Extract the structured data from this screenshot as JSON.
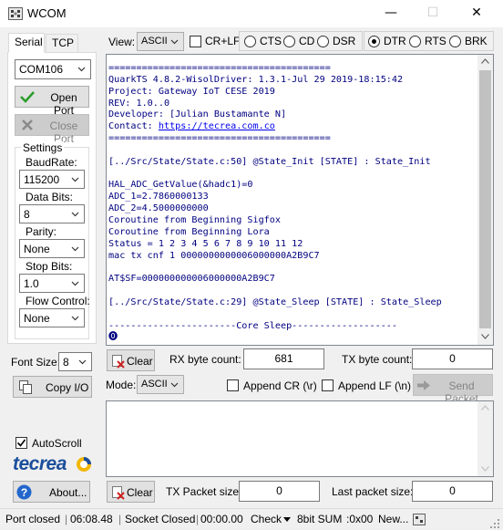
{
  "window": {
    "title": "WCOM",
    "icon": "serial-port-icon",
    "controls": [
      "minimize-icon",
      "maximize-icon",
      "close-icon"
    ]
  },
  "left_panel": {
    "tabs": [
      {
        "label": "Serial",
        "active": true
      },
      {
        "label": "TCP",
        "active": false
      }
    ],
    "port": "COM106",
    "open_port_label": "Open Port",
    "close_port_label": "Close Port",
    "settings": {
      "title": "Settings",
      "baudrate_label": "BaudRate:",
      "baudrate": "115200",
      "databits_label": "Data Bits:",
      "databits": "8",
      "parity_label": "Parity:",
      "parity": "None",
      "stopbits_label": "Stop Bits:",
      "stopbits": "1.0",
      "flow_label": "Flow Control:",
      "flow": "None"
    },
    "font_size_label": "Font Size:",
    "font_size": "8",
    "copy_io_label": "Copy I/O",
    "autoscroll_label": "AutoScroll",
    "autoscroll_checked": true,
    "logo_text": "tecrea",
    "about_label": "About..."
  },
  "toolbar": {
    "view_label": "View:",
    "view_mode": "ASCII",
    "crlf_label": "CR+LF",
    "signals": [
      {
        "label": "CTS",
        "on": false
      },
      {
        "label": "CD",
        "on": false
      },
      {
        "label": "DSR",
        "on": false
      },
      {
        "label": "DTR",
        "on": true
      },
      {
        "label": "RTS",
        "on": false
      },
      {
        "label": "BRK",
        "on": false
      }
    ]
  },
  "console": {
    "lines": [
      "========================================",
      "QuarkTS 4.8.2-WisolDriver: 1.3.1-Jul 29 2019-18:15:42",
      "Project: Gateway IoT CESE 2019",
      "REV: 1.0..0",
      "Developer: [Julian Bustamante N]",
      "Contact: ",
      "========================================",
      "",
      "[../Src/State/State.c:50] @State_Init [STATE] : State_Init",
      "",
      "HAL_ADC_GetValue(&hadc1)=0",
      "ADC_1=2.7860000133",
      "ADC_2=4.5000000000",
      "Coroutine from Beginning Sigfox",
      "Coroutine from Beginning Lora",
      "Status = 1 2 3 4 5 6 7 8 9 10 11 12",
      "mac tx cnf 1 0000000000006000000A2B9C7",
      "",
      "AT$SF=000000000006000000A2B9C7",
      "",
      "[../Src/State/State.c:29] @State_Sleep [STATE] : State_Sleep",
      "",
      "-----------------------Core Sleep-------------------",
      "⓿"
    ],
    "contact_link": "https://tecrea.com.co"
  },
  "rx_row": {
    "clear_label": "Clear",
    "rx_label": "RX byte count:",
    "rx_value": "681",
    "tx_label": "TX byte count:",
    "tx_value": "0"
  },
  "send_row": {
    "mode_label": "Mode:",
    "mode_value": "ASCII",
    "append_cr_label": "Append CR (\\r)",
    "append_lf_label": "Append LF (\\n)",
    "send_label": "Send Packet"
  },
  "tx_row": {
    "clear_label": "Clear",
    "tx_packet_label": "TX Packet size:",
    "tx_packet_value": "0",
    "last_packet_label": "Last packet size:",
    "last_packet_value": "0"
  },
  "status": {
    "port": "Port closed",
    "time1": "06:08.48",
    "socket": "Socket Closed",
    "time2": "00:00.00",
    "check": "Check",
    "sum": "8bit SUM",
    "sum_value": ":0x00",
    "new": "New..."
  },
  "colors": {
    "console_text": "#000080",
    "link": "#0000ee",
    "logo_blue": "#1b4f9c",
    "logo_yellow": "#f2b705"
  }
}
